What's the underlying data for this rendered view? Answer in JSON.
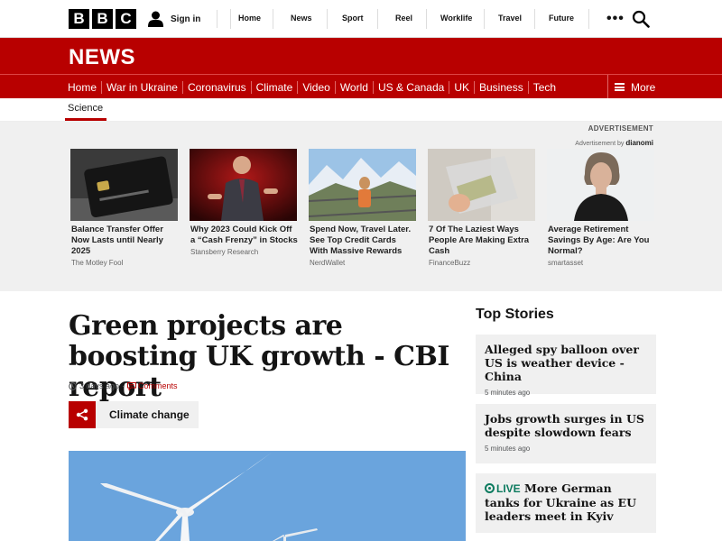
{
  "header": {
    "logo_letters": [
      "B",
      "B",
      "C"
    ],
    "signin_label": "Sign in",
    "nav": [
      "Home",
      "News",
      "Sport",
      "Reel",
      "Worklife",
      "Travel",
      "Future"
    ],
    "more_label": "•••"
  },
  "news": {
    "title": "NEWS",
    "nav": [
      "Home",
      "War in Ukraine",
      "Coronavirus",
      "Climate",
      "Video",
      "World",
      "US & Canada",
      "UK",
      "Business",
      "Tech"
    ],
    "more_label": "More",
    "subnav_active": "Science"
  },
  "ads": {
    "label": "ADVERTISEMENT",
    "by_prefix": "Advertisement by",
    "by_brand": "dianomi",
    "cards": [
      {
        "title": "Balance Transfer Offer Now Lasts until Nearly 2025",
        "source": "The Motley Fool"
      },
      {
        "title": "Why 2023 Could Kick Off a “Cash Frenzy” in Stocks",
        "source": "Stansberry Research"
      },
      {
        "title": "Spend Now, Travel Later. See Top Credit Cards With Massive Rewards",
        "source": "NerdWallet"
      },
      {
        "title": "7 Of The Laziest Ways People Are Making Extra Cash",
        "source": "FinanceBuzz"
      },
      {
        "title": "Average Retirement Savings By Age: Are You Normal?",
        "source": "smartasset"
      }
    ]
  },
  "article": {
    "headline": "Green projects are boosting UK growth - CBI report",
    "time": "3 days ago",
    "separator": "·",
    "comments_label": "Comments",
    "topic": "Climate change"
  },
  "top_stories": {
    "title": "Top Stories",
    "items": [
      {
        "headline": "Alleged spy balloon over US is weather device - China",
        "time": "5 minutes ago"
      },
      {
        "headline": "Jobs growth surges in US despite slowdown fears",
        "time": "5 minutes ago"
      },
      {
        "live_label": "LIVE",
        "headline": "More German tanks for Ukraine as EU leaders meet in Kyiv"
      }
    ]
  },
  "colors": {
    "brand_red": "#b80000",
    "live_green": "#0b7a5e",
    "panel_grey": "#f0f0f0"
  }
}
